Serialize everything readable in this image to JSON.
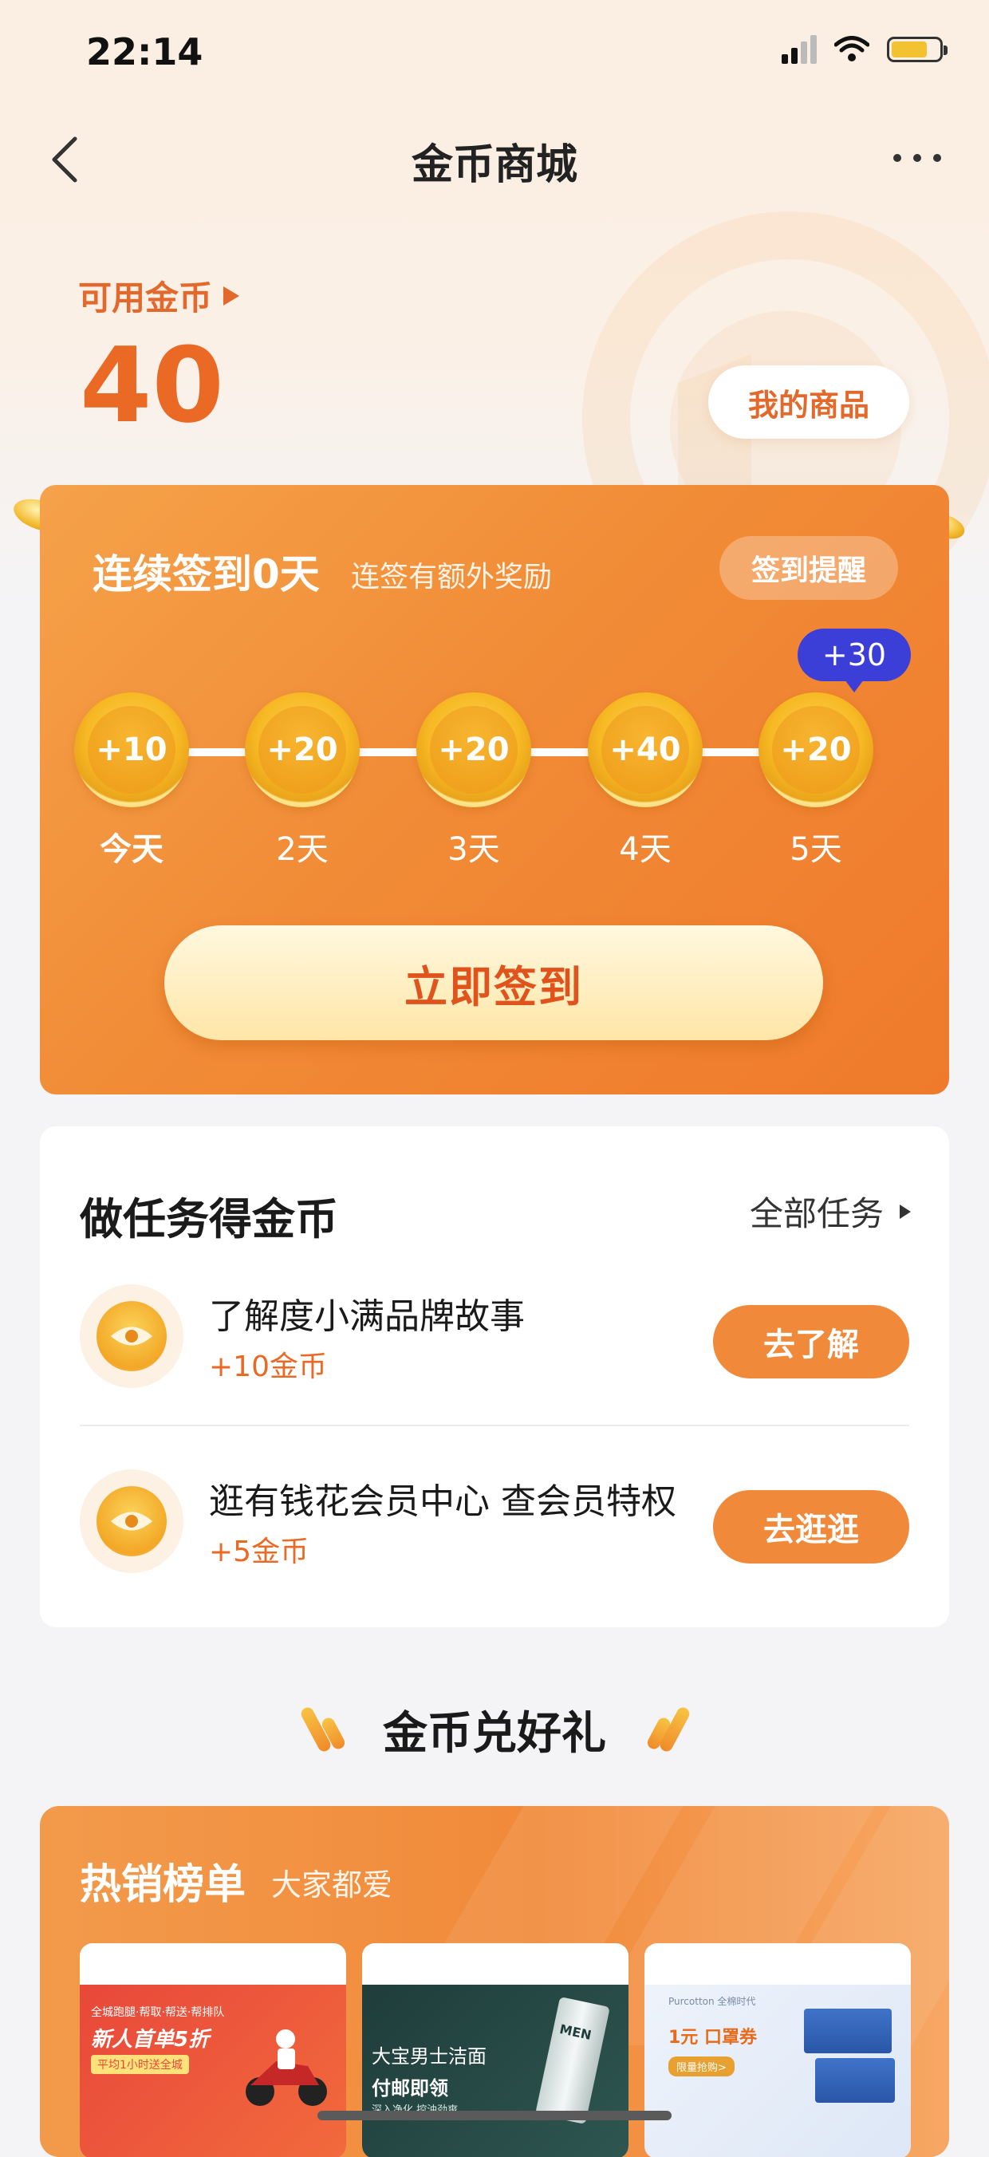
{
  "status_bar": {
    "time": "22:14"
  },
  "nav": {
    "title": "金币商城"
  },
  "coins": {
    "label": "可用金币",
    "value": "40",
    "my_goods_label": "我的商品"
  },
  "sign_in": {
    "title": "连续签到0天",
    "subtitle": "连签有额外奖励",
    "remind_label": "签到提醒",
    "bonus_badge": "+30",
    "days": [
      {
        "reward": "+10",
        "label": "今天"
      },
      {
        "reward": "+20",
        "label": "2天"
      },
      {
        "reward": "+20",
        "label": "3天"
      },
      {
        "reward": "+40",
        "label": "4天"
      },
      {
        "reward": "+20",
        "label": "5天"
      }
    ],
    "button_label": "立即签到"
  },
  "tasks": {
    "title": "做任务得金币",
    "all_label": "全部任务",
    "items": [
      {
        "name": "了解度小满品牌故事",
        "reward": "+10金币",
        "button": "去了解"
      },
      {
        "name": "逛有钱花会员中心 查会员特权",
        "reward": "+5金币",
        "button": "去逛逛"
      }
    ]
  },
  "exchange": {
    "title": "金币兑好礼"
  },
  "hot_list": {
    "title": "热销榜单",
    "subtitle": "大家都爱",
    "products": [
      {
        "ad_line1": "全城跑腿·帮取·帮送·帮排队",
        "ad_headline": "新人首单5折",
        "ad_line2": "平均1小时送全城"
      },
      {
        "ad_headline": "大宝男士洁面",
        "ad_line1": "付邮即领",
        "ad_line2": "深入净化 控油劲爽",
        "tag": "MEN"
      },
      {
        "brand": "Purcotton 全棉时代",
        "ad_headline": "1元 口罩券",
        "ad_line1": "限量抢购>"
      }
    ]
  },
  "colors": {
    "accent": "#ea6a25",
    "card_orange": "#f18b36",
    "bubble_blue": "#3b3fd8"
  }
}
